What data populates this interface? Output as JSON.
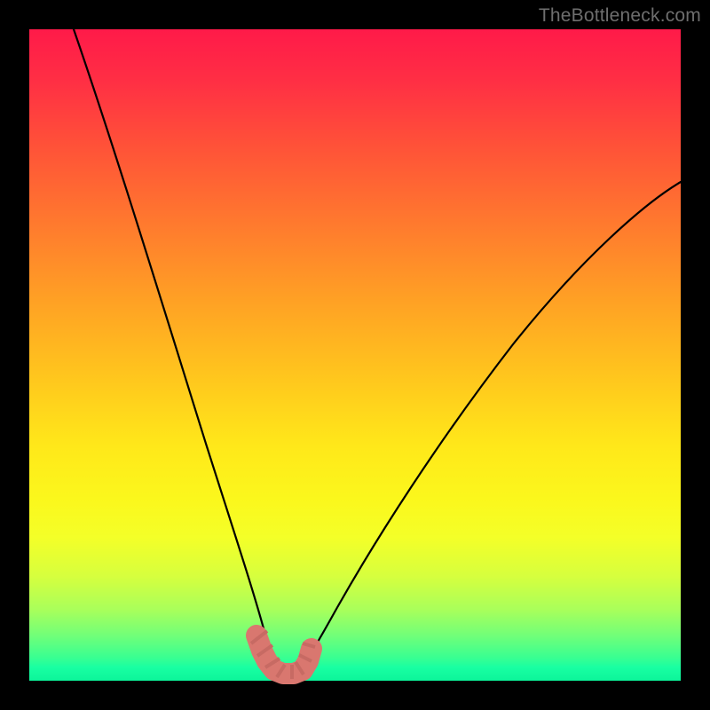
{
  "watermark": "TheBottleneck.com",
  "chart_data": {
    "type": "line",
    "title": "",
    "xlabel": "",
    "ylabel": "",
    "xlim": [
      0,
      100
    ],
    "ylim": [
      0,
      100
    ],
    "grid": false,
    "legend": false,
    "note": "Background color encodes y-value: red = high (top), green = low (bottom). Curve shows a V-shaped minimum near x≈37.",
    "series": [
      {
        "name": "left-branch",
        "x": [
          7,
          10,
          14,
          18,
          22,
          26,
          29,
          32,
          34,
          36,
          37
        ],
        "y": [
          100,
          84,
          66,
          50,
          36,
          24,
          15,
          8,
          4,
          1,
          0
        ]
      },
      {
        "name": "right-branch",
        "x": [
          40,
          42,
          46,
          52,
          60,
          70,
          82,
          95,
          100
        ],
        "y": [
          0,
          1,
          4,
          10,
          20,
          34,
          52,
          70,
          76
        ]
      }
    ],
    "markers": {
      "name": "worm-highlight",
      "color": "#d9776f",
      "points_x": [
        34.5,
        35.5,
        36.5,
        37.5,
        39,
        40.5,
        41.5,
        42.2
      ],
      "points_y": [
        4.5,
        2.2,
        0.9,
        0.3,
        0.3,
        0.6,
        1.8,
        4.0
      ]
    }
  }
}
